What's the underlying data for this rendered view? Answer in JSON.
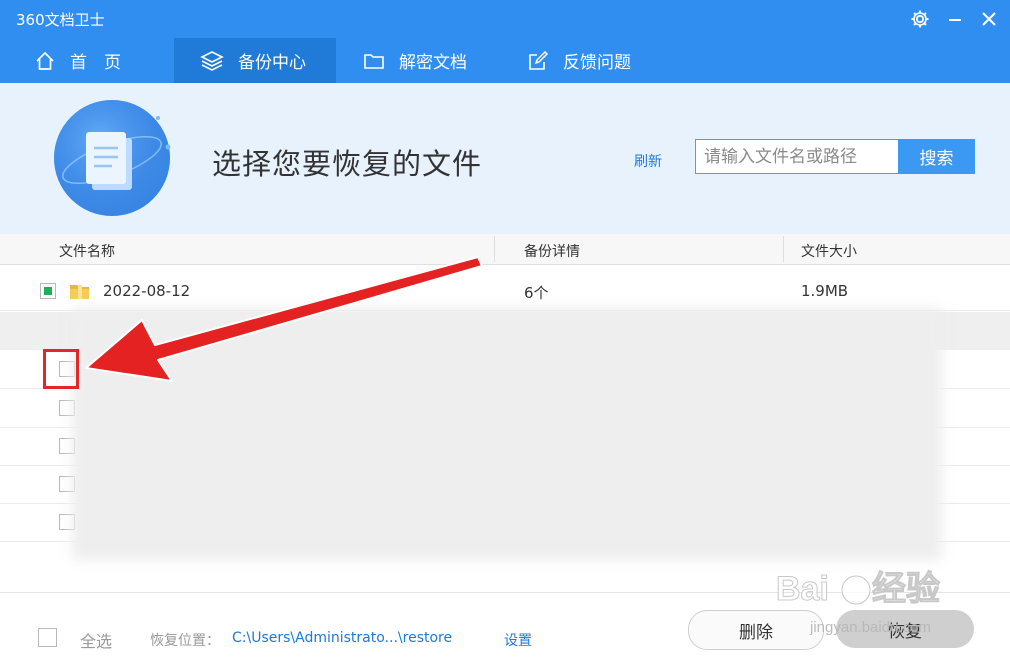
{
  "app": {
    "title": "360文档卫士"
  },
  "window": {
    "settings_icon": "gear-icon",
    "minimize_icon": "minimize-icon",
    "close_icon": "close-icon"
  },
  "nav": {
    "tabs": [
      {
        "label": "首　页",
        "icon": "home-icon"
      },
      {
        "label": "备份中心",
        "icon": "layers-icon",
        "active": true
      },
      {
        "label": "解密文档",
        "icon": "folder-icon"
      },
      {
        "label": "反馈问题",
        "icon": "edit-icon"
      }
    ]
  },
  "hero": {
    "title": "选择您要恢复的文件",
    "refresh": "刷新",
    "search_placeholder": "请输入文件名或路径",
    "search_button": "搜索"
  },
  "table": {
    "columns": [
      "文件名称",
      "备份详情",
      "文件大小"
    ],
    "rows": [
      {
        "name": "2022-08-12",
        "detail": "6个",
        "size": "1.9MB",
        "checked": true
      }
    ]
  },
  "footer": {
    "select_all": "全选",
    "restore_location_label": "恢复位置：",
    "restore_path": "C:\\Users\\Administrato...\\restore",
    "settings_link": "设置",
    "delete_button": "删除",
    "restore_button": "恢复"
  },
  "watermark": {
    "brand": "Baidu经验",
    "url": "jingyan.baidu.com"
  },
  "colors": {
    "primary": "#2f8ef0",
    "active_tab": "#1f7ad8",
    "hero_bg": "#e8f2fd",
    "checked": "#1fb155",
    "annotation": "#e52626"
  }
}
